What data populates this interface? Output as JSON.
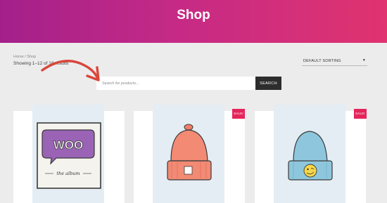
{
  "header": {
    "title": "Shop"
  },
  "breadcrumb": "Home / Shop",
  "result_count": "Showing 1–12 of 18 results",
  "sorting": {
    "selected": "DEFAULT SORTING"
  },
  "search": {
    "placeholder": "Search for products...",
    "button_label": "SEARCH"
  },
  "products": [
    {
      "image": "woo-album-cover",
      "logo_text": "WOO",
      "subtitle": "the album",
      "badge": ""
    },
    {
      "image": "orange-beanie",
      "badge": "SALE!"
    },
    {
      "image": "blue-beanie",
      "badge": "SALE!"
    }
  ],
  "colors": {
    "header_gradient": [
      "#a3208a",
      "#e0336f"
    ],
    "sale_badge": "#e5245b",
    "search_button": "#2d2d2d",
    "arrow": "#d9463b"
  }
}
